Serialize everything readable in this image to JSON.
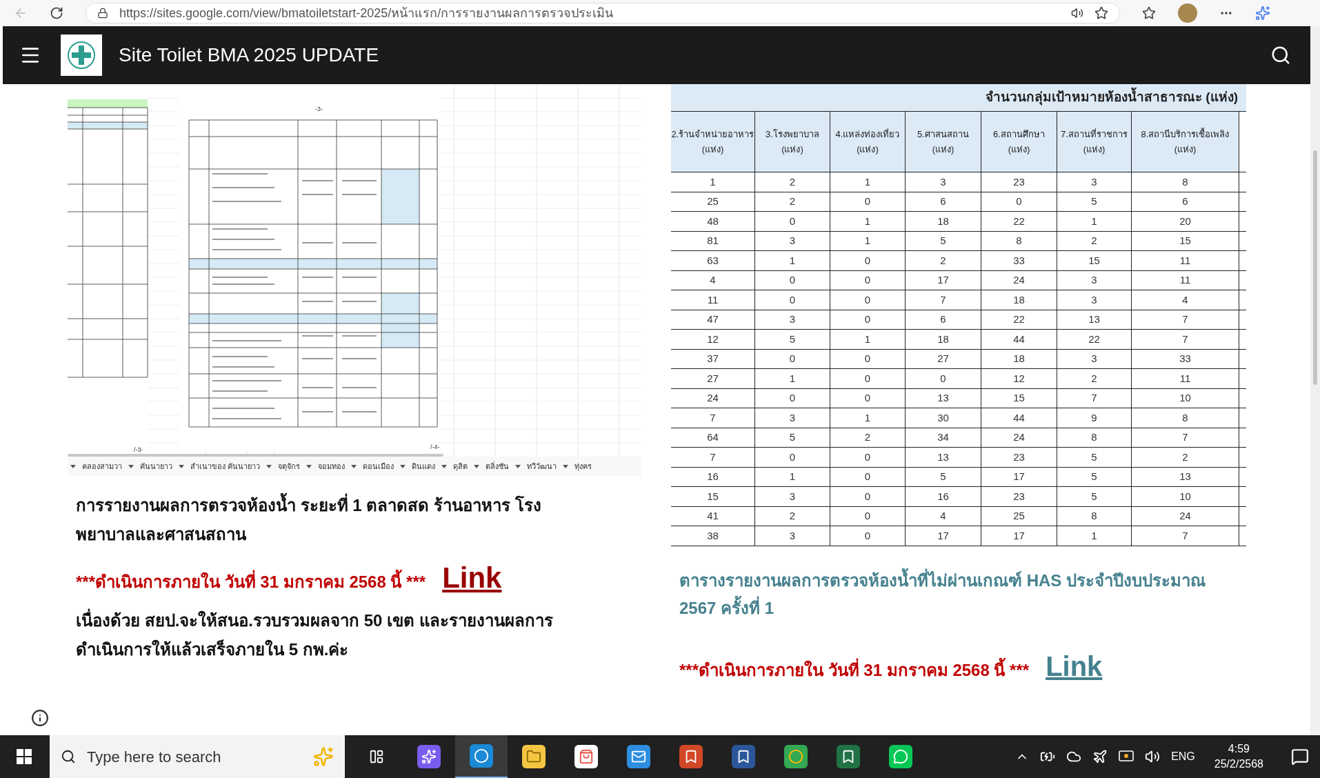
{
  "browser": {
    "url": "https://sites.google.com/view/bmatoiletstart-2025/หน้าแรก/การรายงานผลการตรวจประเมิน"
  },
  "site": {
    "title": "Site Toilet BMA 2025 UPDATE"
  },
  "left_panel": {
    "page_marks": [
      "-3-",
      "/-3-",
      "/-4-"
    ],
    "sheet_tabs": [
      "คลองสามวา",
      "คันนายาว",
      "สำเนาของ คันนายาว",
      "จตุจักร",
      "จอมทอง",
      "ดอนเมือง",
      "ดินแดง",
      "ดุสิต",
      "ตลิ่งชัน",
      "ทวีวัฒนา",
      "ทุ่งคร"
    ],
    "heading": "การรายงานผลการตรวจห้องน้ำ ระยะที่  1 ตลาดสด ร้านอาหาร โรงพยาบาลและศาสนสถาน",
    "notice": {
      "text": "***ดำเนินการภายใน วันที่ 31 มกราคม 2568 นี้ ***",
      "link": "Link"
    },
    "body": "เนื่องด้วย สยป.จะให้สนอ.รวบรวมผลจาก 50 เขต และรายงานผลการดำเนินการให้แล้วเสร็จภายใน 5 กพ.ค่ะ"
  },
  "right_panel": {
    "table": {
      "title": "จำนวนกลุ่มเป้าหมายห้องน้ำสาธารณะ (แห่ง)",
      "columns": [
        {
          "label": "2.ร้านจำหน่ายอาหาร",
          "unit": "(แห่ง)"
        },
        {
          "label": "3.โรงพยาบาล",
          "unit": "(แห่ง)"
        },
        {
          "label": "4.แหล่งท่องเที่ยว",
          "unit": "(แห่ง)"
        },
        {
          "label": "5.ศาสนสถาน",
          "unit": "(แห่ง)"
        },
        {
          "label": "6.สถานศึกษา",
          "unit": "(แห่ง)"
        },
        {
          "label": "7.สถานที่ราชการ",
          "unit": "(แห่ง)"
        },
        {
          "label": "8.สถานีบริการเชื้อเพลิง",
          "unit": "(แห่ง)"
        }
      ],
      "rows": [
        [
          "1",
          "2",
          "1",
          "3",
          "23",
          "3",
          "8"
        ],
        [
          "25",
          "2",
          "0",
          "6",
          "0",
          "5",
          "6"
        ],
        [
          "48",
          "0",
          "1",
          "18",
          "22",
          "1",
          "20"
        ],
        [
          "81",
          "3",
          "1",
          "5",
          "8",
          "2",
          "15"
        ],
        [
          "63",
          "1",
          "0",
          "2",
          "33",
          "15",
          "11"
        ],
        [
          "4",
          "0",
          "0",
          "17",
          "24",
          "3",
          "11"
        ],
        [
          "11",
          "0",
          "0",
          "7",
          "18",
          "3",
          "4"
        ],
        [
          "47",
          "3",
          "0",
          "6",
          "22",
          "13",
          "7"
        ],
        [
          "12",
          "5",
          "1",
          "18",
          "44",
          "22",
          "7"
        ],
        [
          "37",
          "0",
          "0",
          "27",
          "18",
          "3",
          "33"
        ],
        [
          "27",
          "1",
          "0",
          "0",
          "12",
          "2",
          "11"
        ],
        [
          "24",
          "0",
          "0",
          "13",
          "15",
          "7",
          "10"
        ],
        [
          "7",
          "3",
          "1",
          "30",
          "44",
          "9",
          "8"
        ],
        [
          "64",
          "5",
          "2",
          "34",
          "24",
          "8",
          "7"
        ],
        [
          "7",
          "0",
          "0",
          "13",
          "23",
          "5",
          "2"
        ],
        [
          "16",
          "1",
          "0",
          "5",
          "17",
          "5",
          "13"
        ],
        [
          "15",
          "3",
          "0",
          "16",
          "23",
          "5",
          "10"
        ],
        [
          "41",
          "2",
          "0",
          "4",
          "25",
          "8",
          "24"
        ],
        [
          "38",
          "3",
          "0",
          "17",
          "17",
          "1",
          "7"
        ]
      ]
    },
    "heading": "ตารางรายงานผลการตรวจห้องน้ำที่ไม่ผ่านเกณฑ์ HAS ประจำปีงบประมาณ 2567  ครั้งที่ 1",
    "notice": {
      "text": "***ดำเนินการภายใน วันที่ 31 มกราคม 2568 นี้ ***",
      "link": "Link"
    }
  },
  "taskbar": {
    "search": {
      "placeholder": "Type here to search"
    },
    "apps": [
      {
        "kind": "taskview",
        "selected": false
      },
      {
        "kind": "assistant",
        "selected": false
      },
      {
        "kind": "browser",
        "selected": true
      },
      {
        "kind": "folder",
        "selected": false
      },
      {
        "kind": "store",
        "selected": false
      },
      {
        "kind": "mail",
        "selected": false
      },
      {
        "kind": "slides",
        "selected": false
      },
      {
        "kind": "writer",
        "selected": false
      },
      {
        "kind": "web",
        "selected": false
      },
      {
        "kind": "sheet",
        "selected": false
      },
      {
        "kind": "chat",
        "selected": false
      }
    ],
    "tray": {
      "language": "ENG",
      "time": "4:59",
      "date": "25/2/2568"
    }
  }
}
